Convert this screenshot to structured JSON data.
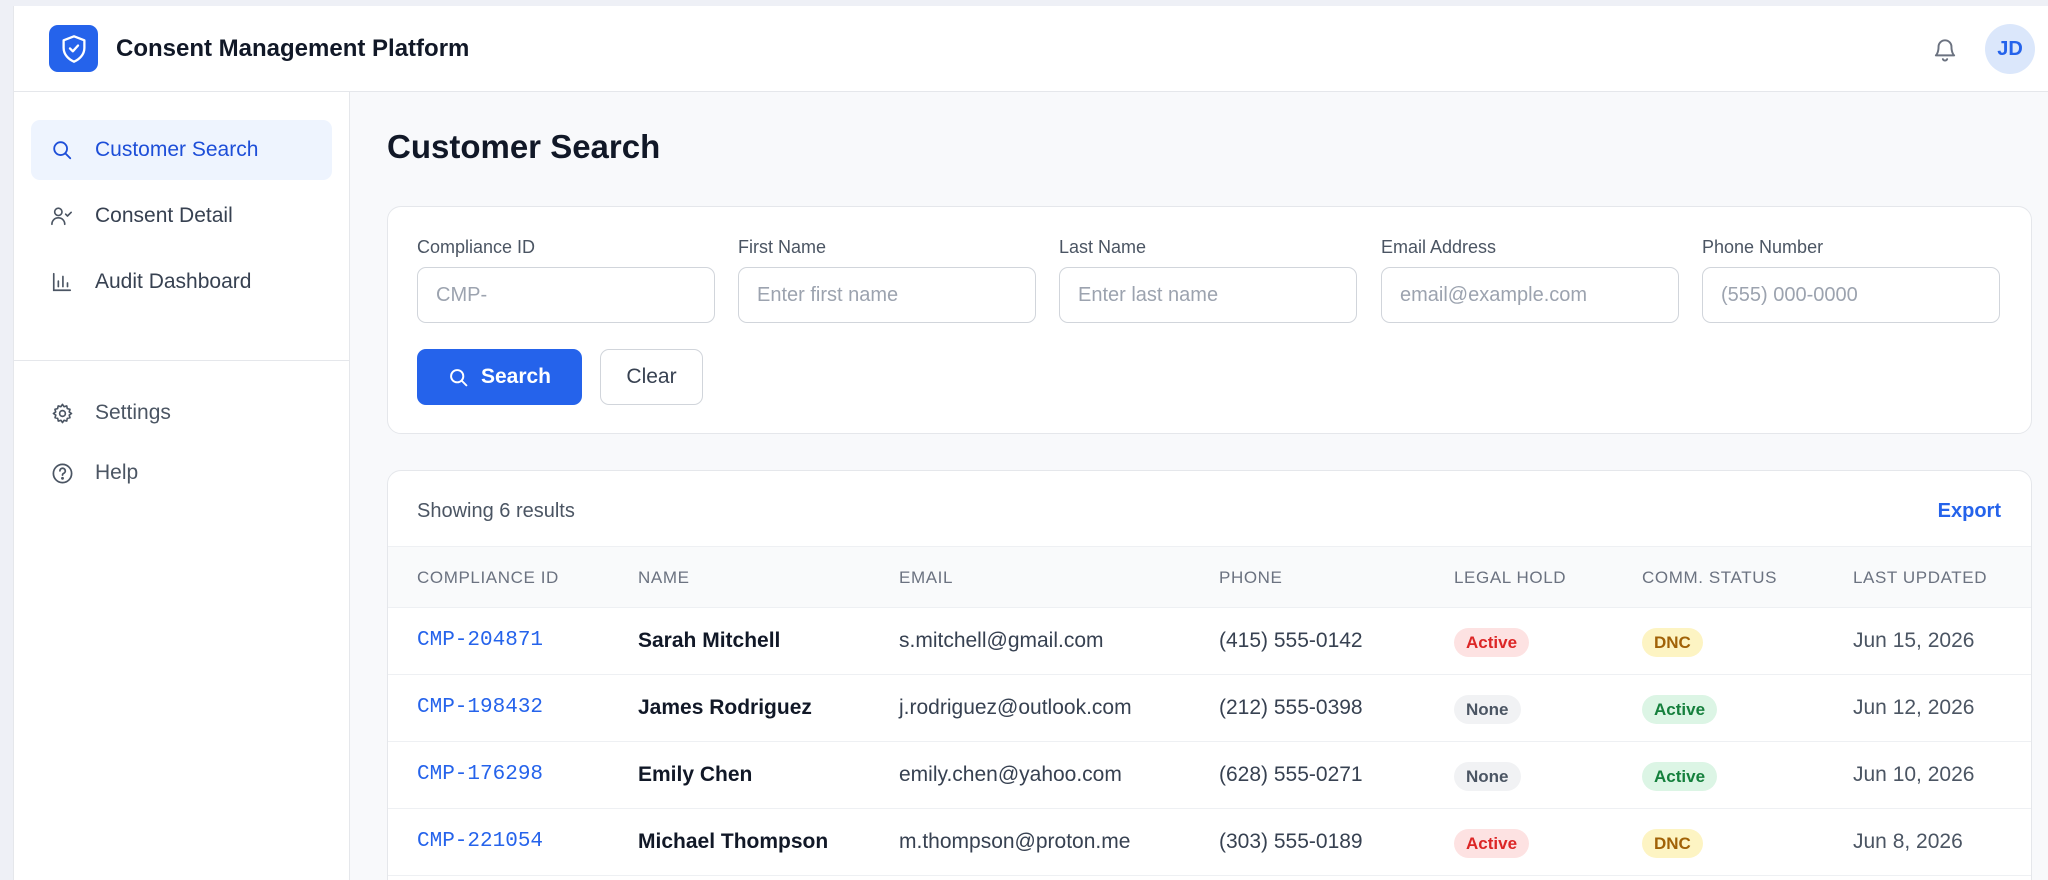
{
  "app": {
    "title": "Consent Management Platform",
    "user_initials": "JD"
  },
  "sidebar": {
    "items": [
      {
        "label": "Customer Search",
        "icon": "search-icon"
      },
      {
        "label": "Consent Detail",
        "icon": "user-check-icon"
      },
      {
        "label": "Audit Dashboard",
        "icon": "bar-chart-icon"
      }
    ],
    "secondary": [
      {
        "label": "Settings",
        "icon": "gear-icon"
      },
      {
        "label": "Help",
        "icon": "help-circle-icon"
      }
    ]
  },
  "page": {
    "title": "Customer Search"
  },
  "search": {
    "fields": [
      {
        "label": "Compliance ID",
        "placeholder": "CMP-"
      },
      {
        "label": "First Name",
        "placeholder": "Enter first name"
      },
      {
        "label": "Last Name",
        "placeholder": "Enter last name"
      },
      {
        "label": "Email Address",
        "placeholder": "email@example.com"
      },
      {
        "label": "Phone Number",
        "placeholder": "(555) 000-0000"
      }
    ],
    "search_label": "Search",
    "clear_label": "Clear"
  },
  "results": {
    "count_text": "Showing 6 results",
    "export_label": "Export",
    "columns": [
      "Compliance ID",
      "Name",
      "Email",
      "Phone",
      "Legal Hold",
      "Comm. Status",
      "Last Updated"
    ],
    "rows": [
      {
        "id": "CMP-204871",
        "name": "Sarah Mitchell",
        "email": "s.mitchell@gmail.com",
        "phone": "(415) 555-0142",
        "legal_hold": "Active",
        "comm_status": "DNC",
        "updated": "Jun 15, 2026"
      },
      {
        "id": "CMP-198432",
        "name": "James Rodriguez",
        "email": "j.rodriguez@outlook.com",
        "phone": "(212) 555-0398",
        "legal_hold": "None",
        "comm_status": "Active",
        "updated": "Jun 12, 2026"
      },
      {
        "id": "CMP-176298",
        "name": "Emily Chen",
        "email": "emily.chen@yahoo.com",
        "phone": "(628) 555-0271",
        "legal_hold": "None",
        "comm_status": "Active",
        "updated": "Jun 10, 2026"
      },
      {
        "id": "CMP-221054",
        "name": "Michael Thompson",
        "email": "m.thompson@proton.me",
        "phone": "(303) 555-0189",
        "legal_hold": "Active",
        "comm_status": "DNC",
        "updated": "Jun 8, 2026"
      }
    ]
  },
  "colors": {
    "accent": "#2563eb",
    "danger": "#dc2626",
    "success": "#15803d",
    "warning": "#a16207"
  }
}
